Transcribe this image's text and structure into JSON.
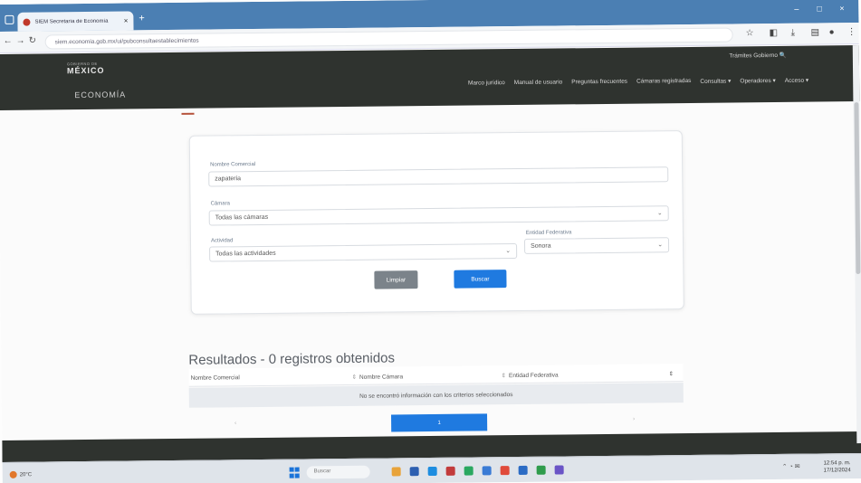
{
  "browser": {
    "tab_title": "SIEM Secretaría de Economía",
    "tab_close": "×",
    "new_tab": "+",
    "url": "siem.economia.gob.mx/ui/pubconsultaestablecimientos",
    "win_min": "–",
    "win_max": "□",
    "win_close": "×"
  },
  "header": {
    "logo_small": "GOBIERNO DE",
    "logo_big": "MÉXICO",
    "economia": "ECONOMÍA",
    "gov_links": "Trámites   Gobierno   🔍",
    "menu": [
      "Marco jurídico",
      "Manual de usuario",
      "Preguntas frecuentes",
      "Cámaras registradas",
      "Consultas ▾",
      "Operadores ▾",
      "Acceso ▾"
    ]
  },
  "form": {
    "name_label": "Nombre Comercial",
    "name_value": "zapateria",
    "camara_label": "Cámara",
    "camara_value": "Todas las cámaras",
    "actividad_label": "Actividad",
    "actividad_value": "Todas las actividades",
    "entidad_label": "Entidad Federativa",
    "entidad_value": "Sonora",
    "clear_label": "Limpiar",
    "search_label": "Buscar"
  },
  "results": {
    "title": "Resultados - 0 registros obtenidos",
    "columns": [
      "Nombre Comercial",
      "Nombre Cámara",
      "Entidad Federativa"
    ],
    "empty_message": "No se encontró información con los criterios seleccionados",
    "page": "1"
  },
  "taskbar": {
    "search_placeholder": "Buscar",
    "weather": "20°C",
    "time": "12:54 p. m.",
    "date": "17/12/2024"
  },
  "colors": {
    "header_bg": "#2f332f",
    "primary": "#1f7ae0",
    "secondary_btn": "#7b838a",
    "tabbar": "#4b7fb3"
  }
}
